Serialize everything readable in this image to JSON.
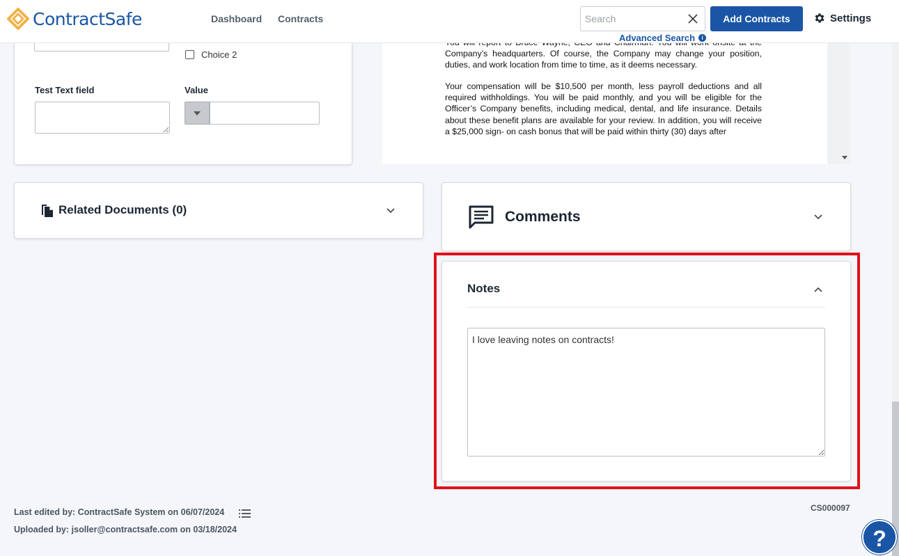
{
  "header": {
    "logo_text": "ContractSafe",
    "nav": [
      {
        "label": "Dashboard"
      },
      {
        "label": "Contracts"
      }
    ],
    "search_placeholder": "Search",
    "advanced_search": "Advanced Search",
    "add_contracts": "Add Contracts",
    "settings": "Settings",
    "brand_color": "#1b55a6"
  },
  "fields_card": {
    "choice_2": "Choice 2",
    "test_text_label": "Test Text field",
    "value_label": "Value"
  },
  "document": {
    "paragraphs": [
      "You will report to Bruce Wayne, CEO and Chairman. You will work onsite at the Company’s headquarters. Of course, the Company may change your position, duties, and work location from time to time, as it deems necessary.",
      "Your compensation will be $10,500 per month, less payroll deductions and all required withholdings. You will be paid monthly, and you will be eligible for the Officer’s Company benefits, including medical, dental, and life insurance. Details about these benefit plans are available for your review. In addition, you will receive a $25,000 sign- on cash bonus that will be paid within thirty (30) days after"
    ]
  },
  "related_documents": {
    "title": "Related Documents (0)"
  },
  "comments": {
    "title": "Comments"
  },
  "notes": {
    "title": "Notes",
    "value": "I love leaving notes on contracts!",
    "highlight_color": "#e0121b"
  },
  "footer": {
    "last_edited": "Last edited by: ContractSafe System on 06/07/2024",
    "uploaded": "Uploaded by: jsoller@contractsafe.com on 03/18/2024",
    "contract_id": "CS000097",
    "help": "?"
  }
}
